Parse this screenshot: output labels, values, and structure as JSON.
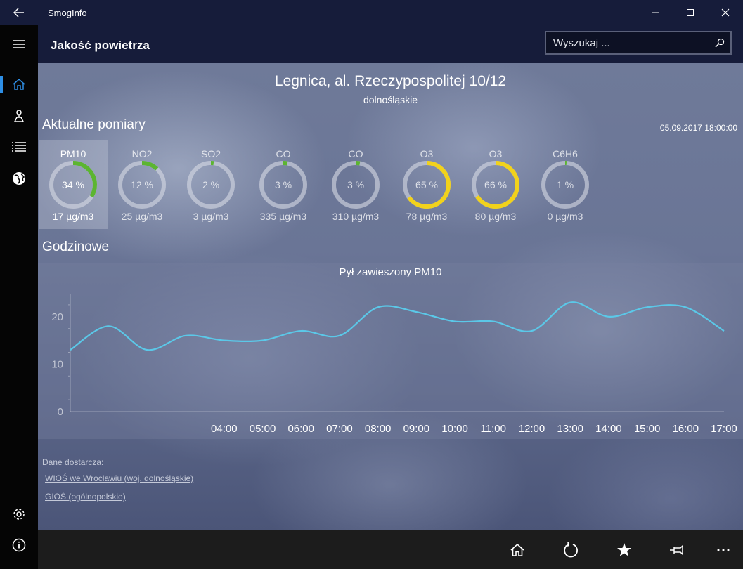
{
  "app": {
    "title": "SmogInfo"
  },
  "header": {
    "title": "Jakość powietrza"
  },
  "search": {
    "placeholder": "Wyszukaj ..."
  },
  "station": {
    "name": "Legnica, al. Rzeczypospolitej 10/12",
    "region": "dolnośląskie"
  },
  "current": {
    "heading": "Aktualne pomiary",
    "timestamp": "05.09.2017 18:00:00",
    "measurements": [
      {
        "name": "PM10",
        "percent": 34,
        "percent_label": "34 %",
        "value": "17 µg/m3",
        "color": "#5cb531",
        "selected": true
      },
      {
        "name": "NO2",
        "percent": 12,
        "percent_label": "12 %",
        "value": "25 µg/m3",
        "color": "#5cb531",
        "selected": false
      },
      {
        "name": "SO2",
        "percent": 2,
        "percent_label": "2 %",
        "value": "3 µg/m3",
        "color": "#5cb531",
        "selected": false
      },
      {
        "name": "CO",
        "percent": 3,
        "percent_label": "3 %",
        "value": "335 µg/m3",
        "color": "#5cb531",
        "selected": false
      },
      {
        "name": "CO",
        "percent": 3,
        "percent_label": "3 %",
        "value": "310 µg/m3",
        "color": "#5cb531",
        "selected": false
      },
      {
        "name": "O3",
        "percent": 65,
        "percent_label": "65 %",
        "value": "78 µg/m3",
        "color": "#f2d21b",
        "selected": false
      },
      {
        "name": "O3",
        "percent": 66,
        "percent_label": "66 %",
        "value": "80 µg/m3",
        "color": "#f2d21b",
        "selected": false
      },
      {
        "name": "C6H6",
        "percent": 1,
        "percent_label": "1 %",
        "value": "0 µg/m3",
        "color": "#5cb531",
        "selected": false
      }
    ]
  },
  "hourly": {
    "heading": "Godzinowe"
  },
  "chart_data": {
    "type": "line",
    "title": "Pył zawieszony PM10",
    "xlabel": "",
    "ylabel": "",
    "ylim": [
      0,
      25
    ],
    "yticks": [
      0,
      10,
      20
    ],
    "x_tick_labels": [
      "04:00",
      "05:00",
      "06:00",
      "07:00",
      "08:00",
      "09:00",
      "10:00",
      "11:00",
      "12:00",
      "13:00",
      "14:00",
      "15:00",
      "16:00",
      "17:00"
    ],
    "x": [
      0,
      1,
      2,
      3,
      4,
      5,
      6,
      7,
      8,
      9,
      10,
      11,
      12,
      13,
      14,
      15,
      16,
      17
    ],
    "values": [
      13,
      18,
      13,
      16,
      15,
      15,
      17,
      16,
      22,
      21,
      19,
      19,
      17,
      23,
      20,
      22,
      22,
      17
    ],
    "line_color": "#5bc8e8",
    "grid": false
  },
  "providers": {
    "label": "Dane dostarcza:",
    "links": [
      "WIOŚ we Wrocławiu (woj. dolnośląskie)",
      "GIOŚ (ogólnopolskie)"
    ]
  },
  "icons": {
    "back": "back-arrow-icon",
    "menu": "hamburger-icon",
    "home": "home-icon",
    "map": "map-pin-icon",
    "list": "list-icon",
    "globe": "globe-icon",
    "settings": "gear-icon",
    "info": "info-icon",
    "search": "search-icon",
    "refresh": "refresh-icon",
    "favorite": "star-icon",
    "pin": "pin-icon",
    "more": "more-icon"
  }
}
